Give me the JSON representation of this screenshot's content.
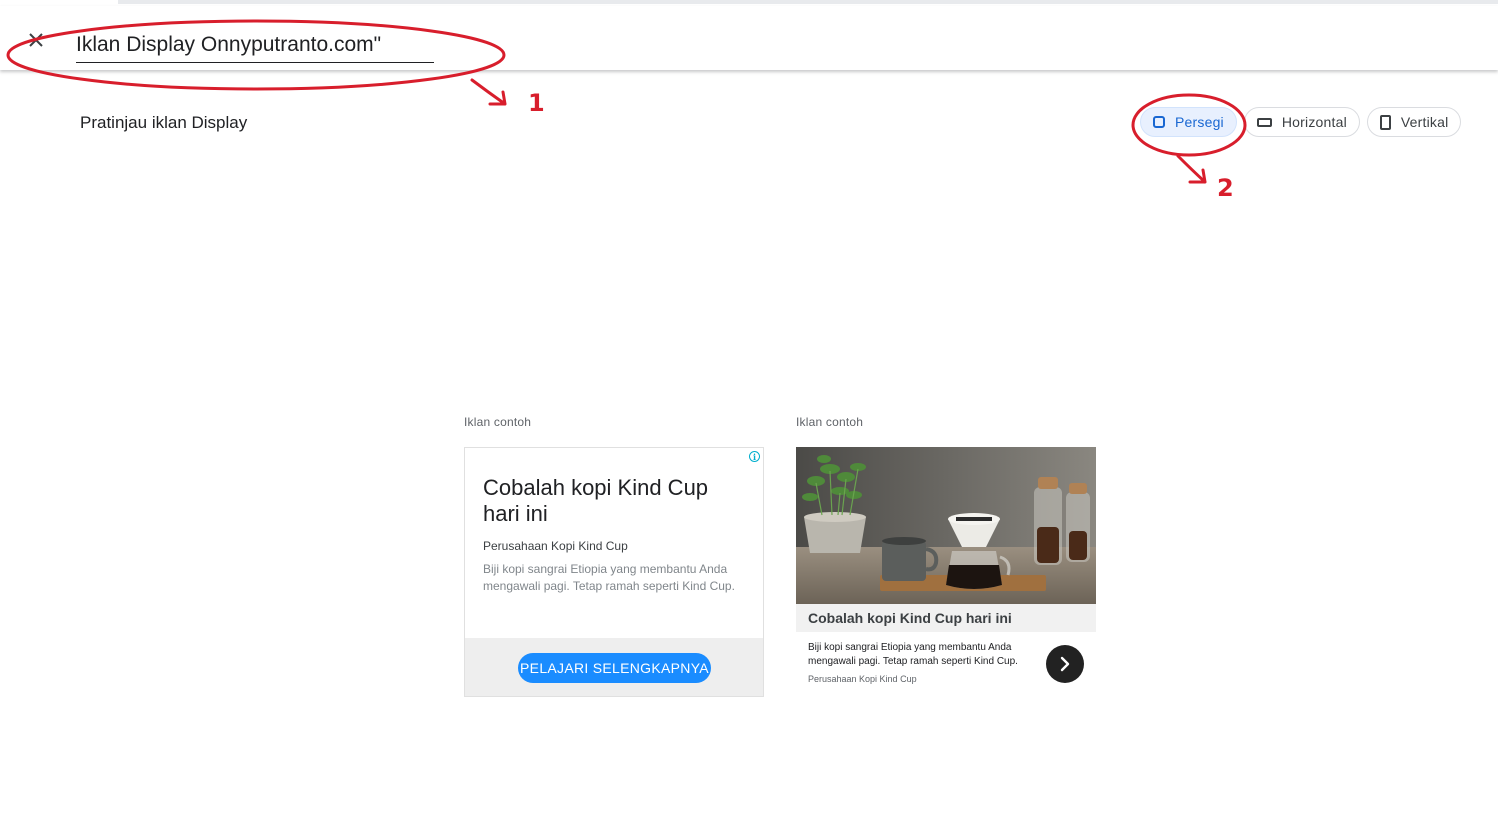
{
  "header": {
    "close_icon": "close-icon",
    "ad_name_value": "Iklan Display Onnyputranto.com\""
  },
  "preview": {
    "title": "Pratinjau iklan Display",
    "formats": [
      {
        "label": "Persegi",
        "icon": "square-icon",
        "selected": true
      },
      {
        "label": "Horizontal",
        "icon": "horizontal-rectangle-icon",
        "selected": false
      },
      {
        "label": "Vertikal",
        "icon": "vertical-rectangle-icon",
        "selected": false
      }
    ]
  },
  "ads": [
    {
      "label": "Iklan contoh",
      "headline": "Cobalah kopi Kind Cup hari ini",
      "company": "Perusahaan Kopi Kind Cup",
      "description": "Biji kopi sangrai Etiopia yang membantu Anda mengawali pagi. Tetap ramah seperti Kind Cup.",
      "cta": "PELAJARI SELENGKAPNYA",
      "info_icon": "adchoices-info-icon"
    },
    {
      "label": "Iklan contoh",
      "headline": "Cobalah kopi Kind Cup hari ini",
      "description": "Biji kopi sangrai Etiopia yang membantu Anda mengawali pagi. Tetap ramah seperti Kind Cup.",
      "company": "Perusahaan Kopi Kind Cup",
      "image": "coffee-pour-over-image",
      "next_icon": "chevron-right-icon"
    }
  ],
  "annotations": {
    "marker_1": "1",
    "marker_2": "2",
    "color": "#d81e2c"
  },
  "colors": {
    "accent": "#1967d2",
    "cta": "#1a8cff",
    "selected_chip_bg": "#e8f0fe"
  }
}
